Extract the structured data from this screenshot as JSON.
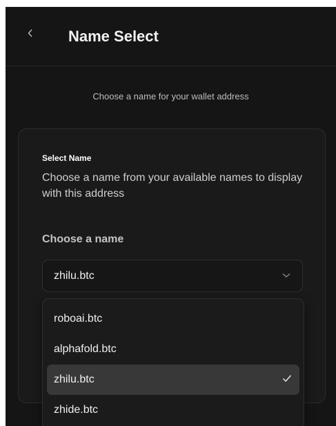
{
  "header": {
    "back_icon": "chevron-left-icon",
    "title": "Name Select"
  },
  "subtitle": "Choose a name for your wallet address",
  "card": {
    "title": "Select Name",
    "description": "Choose a name from your available names to display with this address",
    "field_label": "Choose a name",
    "select": {
      "value": "zhilu.btc",
      "icon": "chevron-down-icon"
    },
    "options": [
      {
        "label": "roboai.btc",
        "selected": false
      },
      {
        "label": "alphafold.btc",
        "selected": false
      },
      {
        "label": "zhilu.btc",
        "selected": true
      },
      {
        "label": "zhide.btc",
        "selected": false
      }
    ],
    "check_icon": "checkmark-icon"
  },
  "colors": {
    "background": "#151515",
    "card": "#1a1a1a",
    "selected_option": "#383838"
  }
}
